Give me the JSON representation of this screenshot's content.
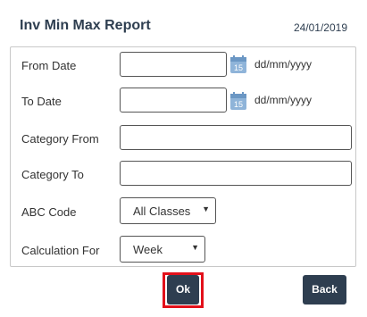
{
  "header": {
    "title": "Inv Min Max Report",
    "date": "24/01/2019"
  },
  "form": {
    "from_date": {
      "label": "From Date",
      "value": "",
      "format": "dd/mm/yyyy",
      "calendar_day": "15"
    },
    "to_date": {
      "label": "To Date",
      "value": "",
      "format": "dd/mm/yyyy",
      "calendar_day": "15"
    },
    "category_from": {
      "label": "Category From",
      "value": ""
    },
    "category_to": {
      "label": "Category To",
      "value": ""
    },
    "abc_code": {
      "label": "ABC Code",
      "selected": "All Classes"
    },
    "calculation_for": {
      "label": "Calculation For",
      "selected": "Week"
    }
  },
  "buttons": {
    "ok_label": "Ok",
    "back_label": "Back"
  },
  "colors": {
    "primary": "#2e3e50",
    "highlight": "#e3101a",
    "calendar": "#8fb4d9"
  }
}
